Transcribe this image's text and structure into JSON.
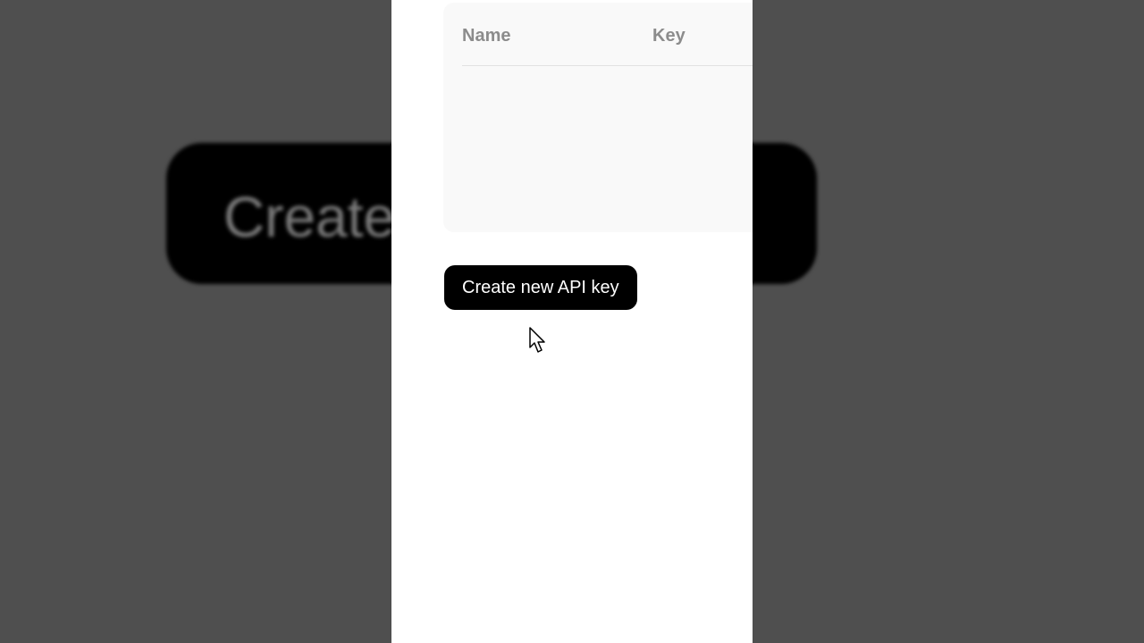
{
  "backdrop": {
    "button_label": "Create"
  },
  "table": {
    "columns": [
      "Name",
      "Key"
    ]
  },
  "actions": {
    "create_label": "Create new API key"
  },
  "cursor": {
    "icon": "arrow-pointer-icon"
  },
  "colors": {
    "button_bg": "#000000",
    "button_text": "#ffffff",
    "header_text": "#8c8c8c",
    "card_bg": "#f9f9f9",
    "backdrop_bg": "#4f4f4f"
  }
}
